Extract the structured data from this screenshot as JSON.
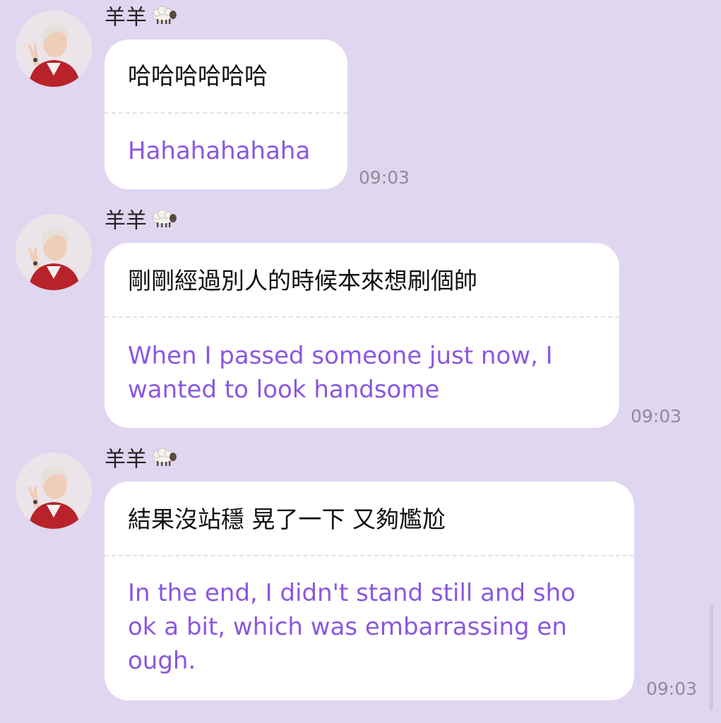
{
  "messages": [
    {
      "sender": "羊羊",
      "sender_emoji": "sheep-icon",
      "original": "哈哈哈哈哈哈",
      "translation": "Hahahahahaha",
      "time": "09:03"
    },
    {
      "sender": "羊羊",
      "sender_emoji": "sheep-icon",
      "original": "剛剛經過別人的時候本來想刷個帥",
      "translation": "When I passed someone just now, I\nwanted to look handsome",
      "time": "09:03"
    },
    {
      "sender": "羊羊",
      "sender_emoji": "sheep-icon",
      "original": "結果沒站穩 晃了一下 又夠尷尬",
      "translation": "In the end, I didn't stand still and sho\nok a bit, which was embarrassing en\nough.",
      "time": "09:03"
    }
  ],
  "colors": {
    "background": "#e0d6f0",
    "bubble": "#ffffff",
    "translation_text": "#8b57e0",
    "timestamp": "#8e8c95"
  }
}
